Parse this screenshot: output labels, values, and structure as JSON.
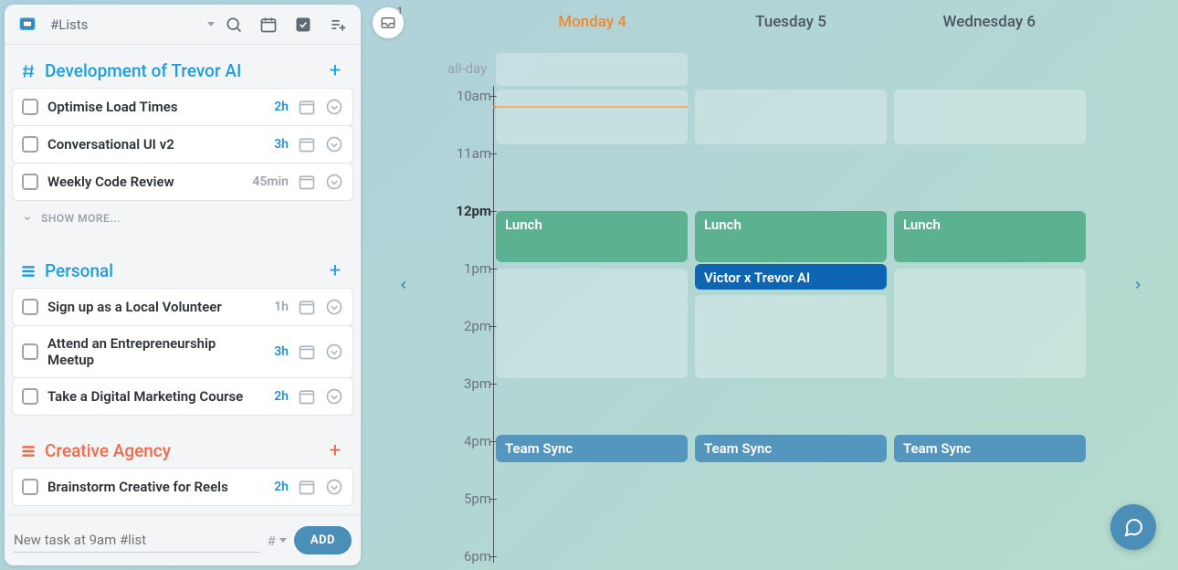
{
  "header": {
    "lists_label": "#Lists"
  },
  "inbox_badge": "1",
  "groups": [
    {
      "key": "dev",
      "title": "Development of Trevor AI",
      "color": "#1f9de0",
      "icon": "hash",
      "tasks": [
        {
          "title": "Optimise Load Times",
          "duration": "2h",
          "duration_muted": false
        },
        {
          "title": "Conversational UI v2",
          "duration": "3h",
          "duration_muted": false
        },
        {
          "title": "Weekly Code Review",
          "duration": "45min",
          "duration_muted": true
        }
      ],
      "show_more": "SHOW MORE..."
    },
    {
      "key": "personal",
      "title": "Personal",
      "color": "#1f9de0",
      "icon": "stack",
      "tasks": [
        {
          "title": "Sign up as a Local Volunteer",
          "duration": "1h",
          "duration_muted": true
        },
        {
          "title": "Attend an Entrepreneurship Meetup",
          "duration": "3h",
          "duration_muted": false
        },
        {
          "title": "Take a Digital Marketing Course",
          "duration": "2h",
          "duration_muted": false
        }
      ]
    },
    {
      "key": "agency",
      "title": "Creative Agency",
      "color": "#f26a4b",
      "icon": "stack",
      "tasks": [
        {
          "title": "Brainstorm Creative for Reels",
          "duration": "2h",
          "duration_muted": false
        }
      ]
    }
  ],
  "footer": {
    "placeholder": "New task at 9am #list",
    "hash": "#",
    "add_label": "ADD"
  },
  "calendar": {
    "allday_label": "all-day",
    "days": [
      {
        "label": "Monday 4",
        "today": true
      },
      {
        "label": "Tuesday 5",
        "today": false
      },
      {
        "label": "Wednesday 6",
        "today": false
      }
    ],
    "hours": [
      {
        "label": "10am"
      },
      {
        "label": "11am"
      },
      {
        "label": "12pm",
        "bold": true
      },
      {
        "label": "1pm"
      },
      {
        "label": "2pm"
      },
      {
        "label": "3pm"
      },
      {
        "label": "4pm"
      },
      {
        "label": "5pm"
      },
      {
        "label": "6pm"
      }
    ],
    "events": {
      "mon": {
        "lunch": "Lunch",
        "sync": "Team Sync"
      },
      "tue": {
        "lunch": "Lunch",
        "meeting": "Victor x Trevor AI",
        "sync": "Team Sync"
      },
      "wed": {
        "lunch": "Lunch",
        "sync": "Team Sync"
      }
    }
  }
}
